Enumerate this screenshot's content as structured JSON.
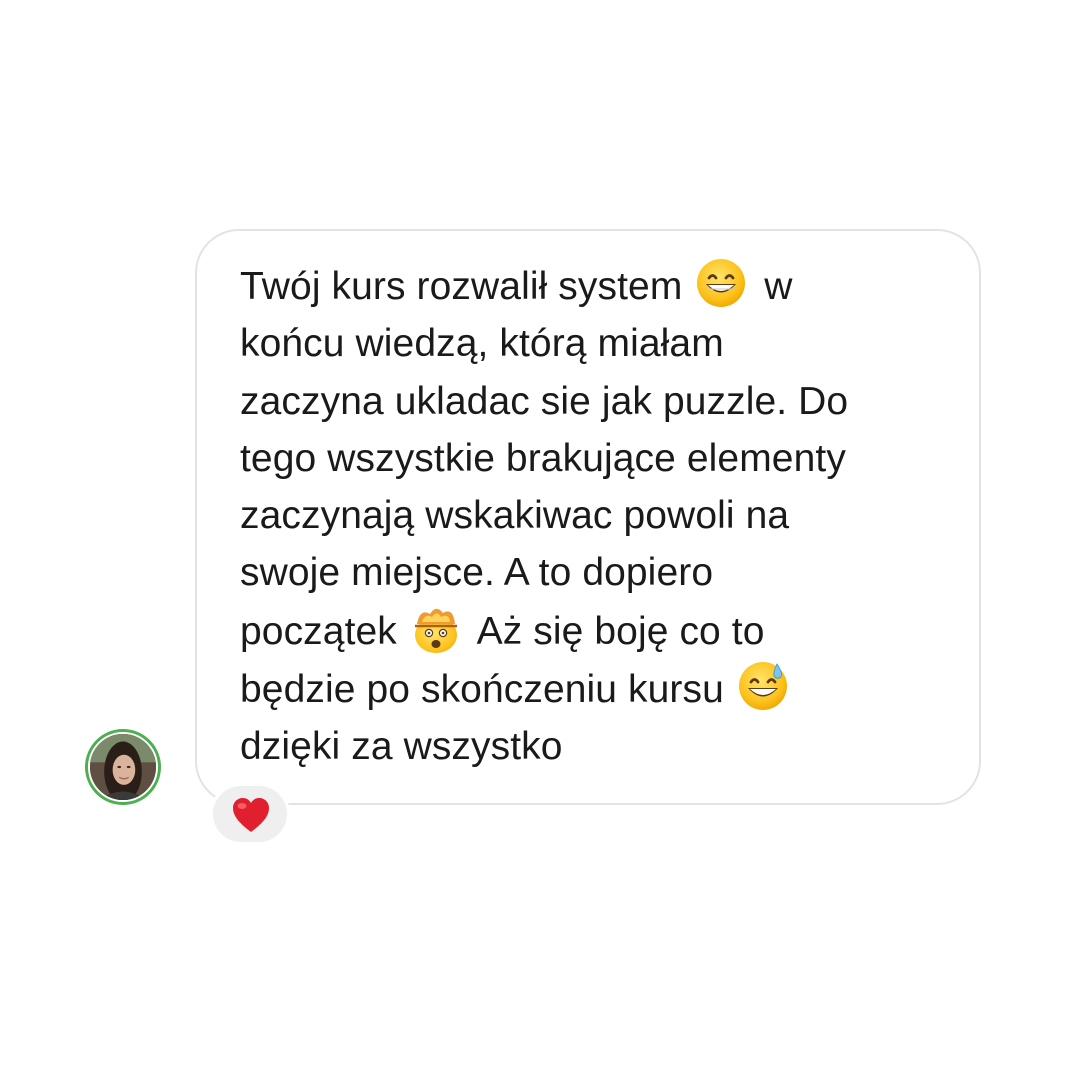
{
  "message": {
    "lines": [
      "Twój kurs rozwalił system",
      "w",
      "końcu wiedzą, którą miałam",
      "zaczyna ukladac sie jak puzzle. Do",
      "tego wszystkie brakujące elementy",
      "zaczynają wskakiwac powoli na",
      "swoje miejsce. A to dopiero",
      "początek",
      "Aż się boję co to",
      "będzie po skończeniu kursu",
      "dzięki za wszystko"
    ],
    "emojis": [
      "grinning-face-icon",
      "exploding-head-icon",
      "sweat-smile-icon"
    ]
  },
  "reaction": {
    "icon": "heart-icon",
    "color": "#e0202e"
  },
  "avatar": {
    "ring_color": "#4caf50"
  }
}
